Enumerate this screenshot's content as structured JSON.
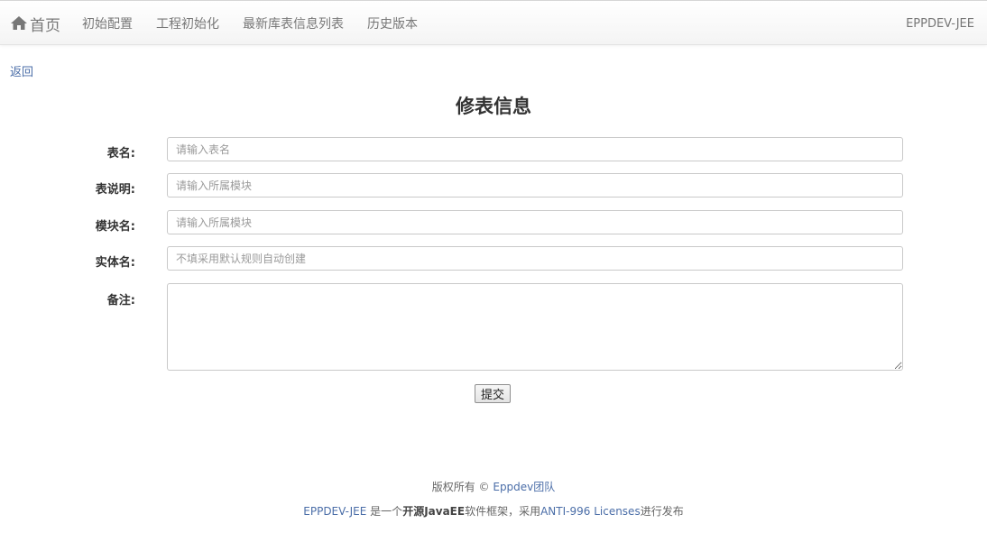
{
  "navbar": {
    "brand_label": "首页",
    "brand_icon": "home-icon",
    "links": [
      "初始配置",
      "工程初始化",
      "最新库表信息列表",
      "历史版本"
    ],
    "right_label": "EPPDEV-JEE"
  },
  "back_label": "返回",
  "page_title": "修表信息",
  "form": {
    "table_name": {
      "label": "表名:",
      "value": "",
      "placeholder": "请输入表名"
    },
    "table_desc": {
      "label": "表说明:",
      "value": "",
      "placeholder": "请输入所属模块"
    },
    "module_name": {
      "label": "模块名:",
      "value": "",
      "placeholder": "请输入所属模块"
    },
    "entity_name": {
      "label": "实体名:",
      "value": "",
      "placeholder": "不填采用默认规则自动创建"
    },
    "remark": {
      "label": "备注:",
      "value": ""
    },
    "submit_label": "提交"
  },
  "footer": {
    "copyright_prefix": "版权所有 © ",
    "copyright_link": "Eppdev团队",
    "project_link": "EPPDEV-JEE",
    "text_is": " 是一个",
    "text_bold": "开源JavaEE",
    "text_mid": "软件框架，采用",
    "license_link": "ANTI-996 Licenses",
    "text_end": "进行发布"
  },
  "colors": {
    "link": "#4b6ea8",
    "nav_text": "#777777",
    "title": "#333333"
  }
}
